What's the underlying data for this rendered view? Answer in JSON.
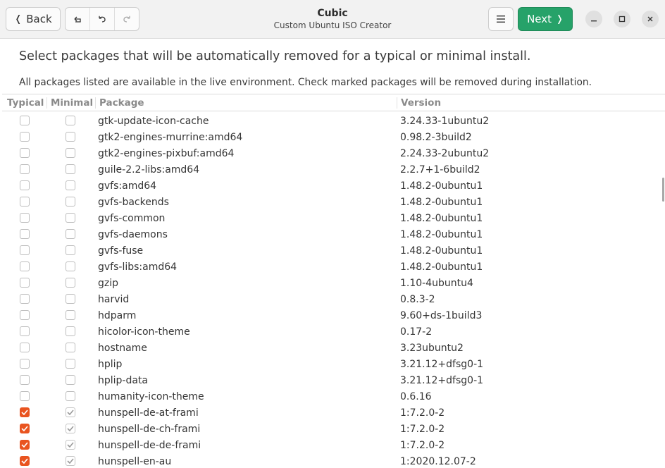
{
  "header": {
    "back_label": "Back",
    "title": "Cubic",
    "subtitle": "Custom Ubuntu ISO Creator",
    "next_label": "Next"
  },
  "icons": {
    "back": "chevron-left-icon",
    "undo": "undo-icon",
    "undo_step": "undo-step-icon",
    "redo": "redo-icon",
    "menu": "hamburger-menu-icon",
    "next": "chevron-right-icon",
    "minimize": "minimize-icon",
    "maximize": "maximize-icon",
    "close": "close-icon"
  },
  "colors": {
    "accent_next": "#26a269",
    "checkbox_checked": "#e95420"
  },
  "page": {
    "heading": "Select packages that will be automatically removed for a typical or minimal install.",
    "description": "All packages listed are available in the live environment. Check marked packages will be removed during installation."
  },
  "table": {
    "columns": [
      "Typical",
      "Minimal",
      "Package",
      "Version"
    ],
    "rows": [
      {
        "typical": false,
        "minimal": false,
        "package": "gtk-update-icon-cache",
        "version": "3.24.33-1ubuntu2"
      },
      {
        "typical": false,
        "minimal": false,
        "package": "gtk2-engines-murrine:amd64",
        "version": "0.98.2-3build2"
      },
      {
        "typical": false,
        "minimal": false,
        "package": "gtk2-engines-pixbuf:amd64",
        "version": "2.24.33-2ubuntu2"
      },
      {
        "typical": false,
        "minimal": false,
        "package": "guile-2.2-libs:amd64",
        "version": "2.2.7+1-6build2"
      },
      {
        "typical": false,
        "minimal": false,
        "package": "gvfs:amd64",
        "version": "1.48.2-0ubuntu1"
      },
      {
        "typical": false,
        "minimal": false,
        "package": "gvfs-backends",
        "version": "1.48.2-0ubuntu1"
      },
      {
        "typical": false,
        "minimal": false,
        "package": "gvfs-common",
        "version": "1.48.2-0ubuntu1"
      },
      {
        "typical": false,
        "minimal": false,
        "package": "gvfs-daemons",
        "version": "1.48.2-0ubuntu1"
      },
      {
        "typical": false,
        "minimal": false,
        "package": "gvfs-fuse",
        "version": "1.48.2-0ubuntu1"
      },
      {
        "typical": false,
        "minimal": false,
        "package": "gvfs-libs:amd64",
        "version": "1.48.2-0ubuntu1"
      },
      {
        "typical": false,
        "minimal": false,
        "package": "gzip",
        "version": "1.10-4ubuntu4"
      },
      {
        "typical": false,
        "minimal": false,
        "package": "harvid",
        "version": "0.8.3-2"
      },
      {
        "typical": false,
        "minimal": false,
        "package": "hdparm",
        "version": "9.60+ds-1build3"
      },
      {
        "typical": false,
        "minimal": false,
        "package": "hicolor-icon-theme",
        "version": "0.17-2"
      },
      {
        "typical": false,
        "minimal": false,
        "package": "hostname",
        "version": "3.23ubuntu2"
      },
      {
        "typical": false,
        "minimal": false,
        "package": "hplip",
        "version": "3.21.12+dfsg0-1"
      },
      {
        "typical": false,
        "minimal": false,
        "package": "hplip-data",
        "version": "3.21.12+dfsg0-1"
      },
      {
        "typical": false,
        "minimal": false,
        "package": "humanity-icon-theme",
        "version": "0.6.16"
      },
      {
        "typical": true,
        "minimal": true,
        "package": "hunspell-de-at-frami",
        "version": "1:7.2.0-2"
      },
      {
        "typical": true,
        "minimal": true,
        "package": "hunspell-de-ch-frami",
        "version": "1:7.2.0-2"
      },
      {
        "typical": true,
        "minimal": true,
        "package": "hunspell-de-de-frami",
        "version": "1:7.2.0-2"
      },
      {
        "typical": true,
        "minimal": true,
        "package": "hunspell-en-au",
        "version": "1:2020.12.07-2"
      }
    ]
  }
}
